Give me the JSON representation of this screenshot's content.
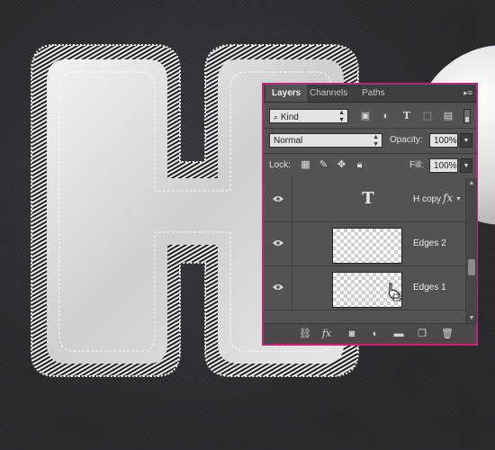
{
  "panel": {
    "tabs": [
      {
        "label": "Layers",
        "active": true
      },
      {
        "label": "Channels",
        "active": false
      },
      {
        "label": "Paths",
        "active": false
      }
    ],
    "menu_icon": "panel-menu-icon",
    "filter": {
      "kind_label": "Kind",
      "icons": [
        "image-filter-icon",
        "adjustment-filter-icon",
        "type-filter-icon",
        "shape-filter-icon",
        "smart-object-filter-icon"
      ]
    },
    "blend_mode": "Normal",
    "opacity_label": "Opacity:",
    "opacity_value": "100%",
    "lock_label": "Lock:",
    "lock_icons": [
      "lock-transparent-pixels-icon",
      "lock-image-pixels-icon",
      "lock-position-icon",
      "lock-all-icon"
    ],
    "fill_label": "Fill:",
    "fill_value": "100%",
    "layers": [
      {
        "name": "H copy",
        "type": "text",
        "visible": true,
        "has_fx": true,
        "thumb_glyph": "T"
      },
      {
        "name": "Edges 2",
        "type": "raster",
        "visible": true,
        "has_fx": false
      },
      {
        "name": "Edges 1",
        "type": "raster",
        "visible": true,
        "has_fx": false
      }
    ],
    "fx_label": "fx",
    "footer_icons": [
      "link-layers-icon",
      "add-layer-style-icon",
      "add-mask-icon",
      "new-adjustment-layer-icon",
      "new-group-icon",
      "new-layer-icon",
      "delete-layer-icon"
    ]
  },
  "colors": {
    "panel_border": "#c2237e",
    "panel_bg": "#535353",
    "background": "#2d2d31"
  }
}
